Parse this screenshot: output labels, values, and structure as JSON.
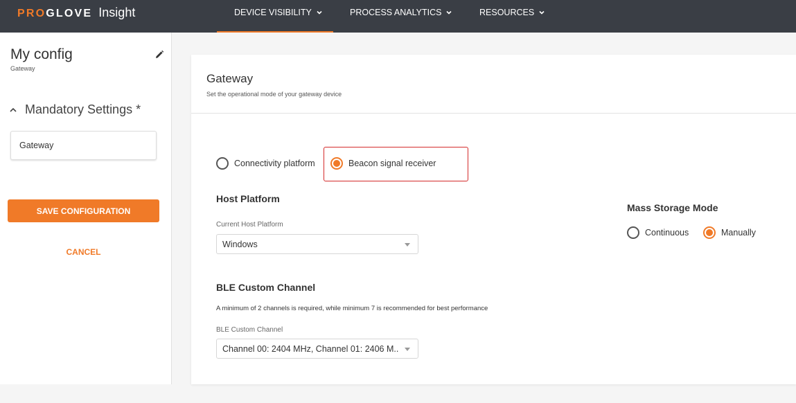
{
  "brand": {
    "pro": "PRO",
    "glove": "GLOVE",
    "insight": "Insight",
    "accent": "#f07a28",
    "bar_color": "#3a3e45"
  },
  "nav": {
    "items": [
      {
        "label": "DEVICE VISIBILITY",
        "icon": "chevron-down-icon"
      },
      {
        "label": "PROCESS ANALYTICS",
        "icon": "chevron-down-icon"
      },
      {
        "label": "RESOURCES",
        "icon": "chevron-down-icon"
      }
    ]
  },
  "sidebar": {
    "title": "My config",
    "subtitle": "Gateway",
    "edit_icon": "pencil-icon",
    "section_label": "Mandatory Settings *",
    "section_icon": "chevron-up-icon",
    "item": "Gateway",
    "save_label": "SAVE CONFIGURATION",
    "cancel_label": "CANCEL"
  },
  "main": {
    "title": "Gateway",
    "subtitle": "Set the operational mode of your gateway device",
    "mode_options": [
      {
        "label": "Connectivity platform",
        "selected": false
      },
      {
        "label": "Beacon signal receiver",
        "selected": true
      }
    ],
    "host_platform": {
      "title": "Host Platform",
      "field_label": "Current Host Platform",
      "value": "Windows"
    },
    "mass_storage": {
      "title": "Mass Storage Mode",
      "options": [
        {
          "label": "Continuous",
          "selected": false
        },
        {
          "label": "Manually",
          "selected": true
        }
      ]
    },
    "ble": {
      "title": "BLE Custom Channel",
      "helper": "A minimum of 2 channels is required, while minimum 7 is recommended for best performance",
      "field_label": "BLE Custom Channel",
      "value": "Channel 00: 2404 MHz, Channel 01: 2406 M..."
    }
  }
}
